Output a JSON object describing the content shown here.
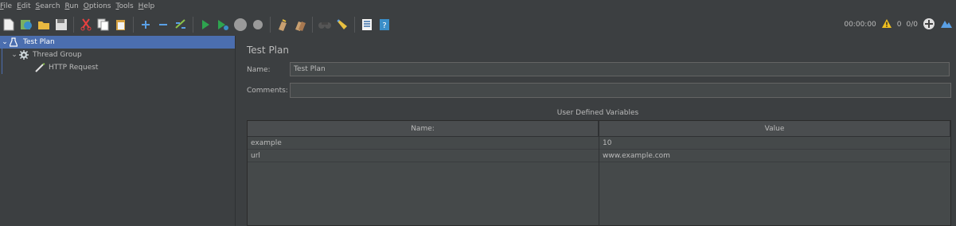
{
  "menu": [
    {
      "mnemonic": "F",
      "rest": "ile"
    },
    {
      "mnemonic": "E",
      "rest": "dit"
    },
    {
      "mnemonic": "S",
      "rest": "earch"
    },
    {
      "mnemonic": "R",
      "rest": "un"
    },
    {
      "mnemonic": "O",
      "rest": "ptions"
    },
    {
      "mnemonic": "T",
      "rest": "ools"
    },
    {
      "mnemonic": "H",
      "rest": "elp"
    }
  ],
  "toolbar": {
    "icons": [
      "new-icon",
      "templates-icon",
      "open-icon",
      "save-icon",
      "cut-icon",
      "copy-icon",
      "paste-icon",
      "expand-icon",
      "collapse-icon",
      "toggle-icon",
      "start-icon",
      "start-no-pauses-icon",
      "stop-icon",
      "shutdown-icon",
      "clear-icon",
      "clear-all-icon",
      "search-icon",
      "reset-search-icon",
      "function-helper-icon",
      "help-icon"
    ],
    "timer": "00:00:00",
    "warning_count": "0",
    "threads": "0/0"
  },
  "tree": {
    "items": [
      {
        "label": "Test Plan",
        "icon": "test-plan-icon",
        "selected": true
      },
      {
        "label": "Thread Group",
        "icon": "gear-icon",
        "selected": false
      },
      {
        "label": "HTTP Request",
        "icon": "pipette-icon",
        "selected": false
      }
    ]
  },
  "main": {
    "title": "Test Plan",
    "name_label": "Name:",
    "name_value": "Test Plan",
    "comments_label": "Comments:",
    "comments_value": "",
    "udv_title": "User Defined Variables",
    "table": {
      "headers": [
        "Name:",
        "Value"
      ],
      "rows": [
        [
          "example",
          "10"
        ],
        [
          "url",
          "www.example.com"
        ]
      ]
    }
  },
  "colors": {
    "background": "#3c3f41",
    "selection": "#4b6eaf",
    "text": "#bbbbbb",
    "input_bg": "#45494a"
  }
}
